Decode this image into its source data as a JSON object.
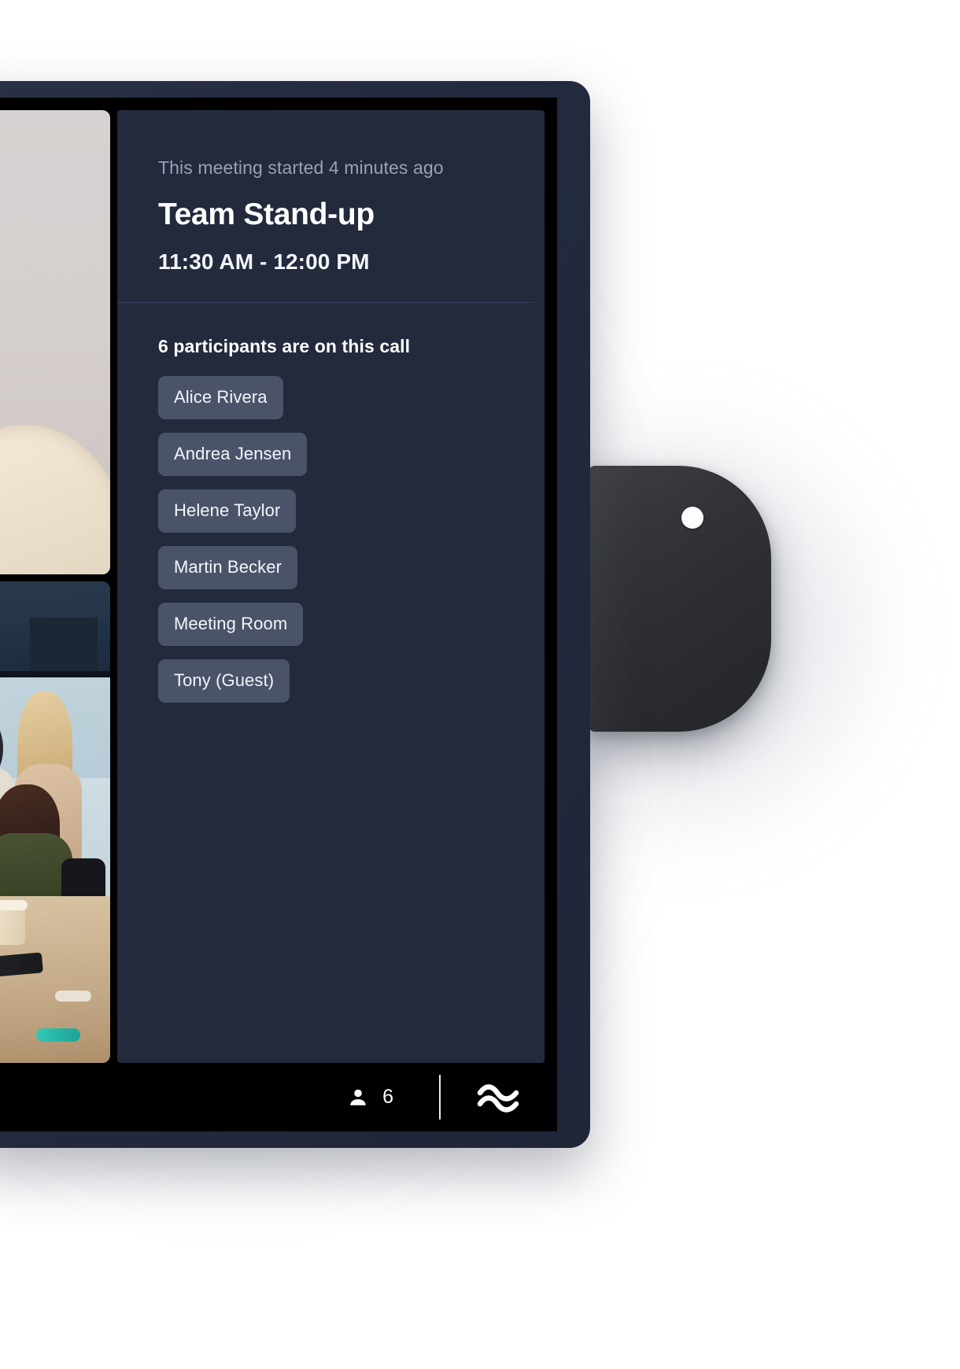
{
  "meeting": {
    "started_text": "This meeting started 4 minutes ago",
    "title": "Team Stand-up",
    "time_range": "11:30 AM - 12:00 PM"
  },
  "participants": {
    "heading": "6 participants are on this call",
    "list": [
      {
        "name": "Alice Rivera"
      },
      {
        "name": "Andrea Jensen"
      },
      {
        "name": "Helene Taylor"
      },
      {
        "name": "Martin Becker"
      },
      {
        "name": "Meeting Room"
      },
      {
        "name": "Tony (Guest)"
      }
    ]
  },
  "statusbar": {
    "people_icon": "person-icon",
    "people_count": "6",
    "signal_icon": "wave-icon"
  },
  "video_tiles": [
    {
      "label": "participant-video-top"
    },
    {
      "label": "meeting-room-video-bottom"
    }
  ],
  "colors": {
    "panel_bg": "#222a3c",
    "chip_bg": "#4b5369",
    "bezel": "#242b3f",
    "screen_black": "#000000",
    "muted_text": "#98a1b5",
    "white": "#ffffff",
    "divider": "#38405a"
  }
}
